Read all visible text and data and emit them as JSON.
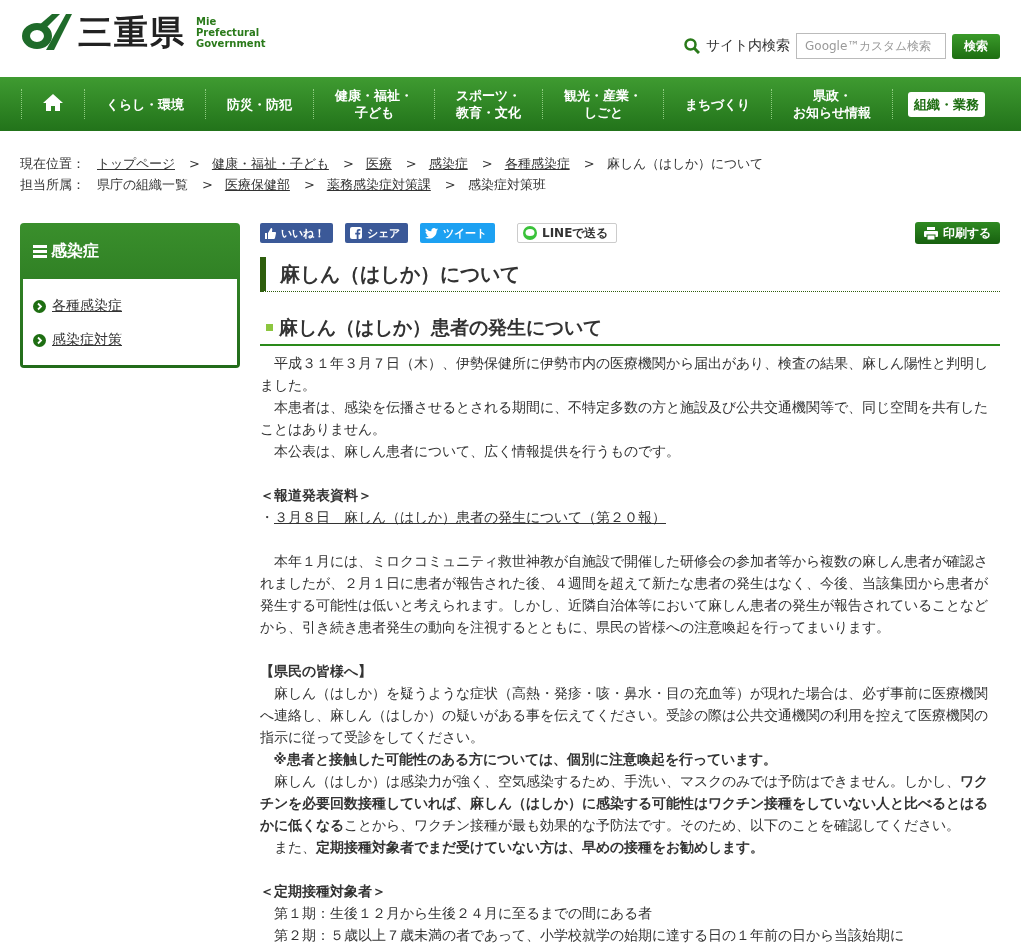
{
  "header": {
    "logo_name": "三重県",
    "logo_subtitle": "Mie\nPrefectural\nGovernment",
    "search_label": "サイト内検索",
    "search": {
      "placeholder": "Google™カスタム検索"
    },
    "search_button": "検索"
  },
  "nav": {
    "items": [
      {
        "kind": "home",
        "selected": false
      },
      {
        "kind": "link",
        "label": "くらし・環境",
        "selected": false
      },
      {
        "kind": "link",
        "label": "防災・防犯",
        "selected": false
      },
      {
        "kind": "link",
        "lines": [
          "健康・福祉・",
          "子ども"
        ],
        "selected": false
      },
      {
        "kind": "link",
        "lines": [
          "スポーツ・",
          "教育・文化"
        ],
        "selected": false
      },
      {
        "kind": "link",
        "lines": [
          "観光・産業・",
          "しごと"
        ],
        "selected": false
      },
      {
        "kind": "link",
        "label": "まちづくり",
        "selected": false
      },
      {
        "kind": "link",
        "lines": [
          "県政・",
          "お知らせ情報"
        ],
        "selected": false
      },
      {
        "kind": "link",
        "label": "組織・業務",
        "selected": true
      }
    ]
  },
  "breadcrumbs": [
    {
      "label": "現在位置：",
      "separator": ">",
      "items": [
        {
          "text": "トップページ",
          "link": true
        },
        {
          "text": "健康・福祉・子ども",
          "link": true
        },
        {
          "text": "医療",
          "link": true
        },
        {
          "text": "感染症",
          "link": true
        },
        {
          "text": "各種感染症",
          "link": true
        },
        {
          "text": "麻しん（はしか）について",
          "link": false
        }
      ]
    },
    {
      "label": "担当所属：",
      "separator": ">",
      "items": [
        {
          "text": "県庁の組織一覧",
          "link": false
        },
        {
          "text": "医療保健部",
          "link": true
        },
        {
          "text": "薬務感染症対策課",
          "link": true
        },
        {
          "text": "感染症対策班",
          "link": false
        }
      ]
    }
  ],
  "sidebar": {
    "title": "感染症",
    "items": [
      "各種感染症",
      "感染症対策"
    ]
  },
  "share_buttons": [
    {
      "kind": "like",
      "label": "いいね！"
    },
    {
      "kind": "share",
      "label": "シェア"
    },
    {
      "kind": "tweet",
      "label": "ツイート"
    },
    {
      "kind": "line",
      "label": "LINEで送る"
    }
  ],
  "print_button": "印刷する",
  "title": "麻しん（はしか）について",
  "subtitle": "麻しん（はしか）患者の発生について",
  "sections": [
    {
      "blocks": [
        {
          "kind": "para",
          "text": "平成３１年３月７日（木）、伊勢保健所に伊勢市内の医療機関から届出があり、検査の結果、麻しん陽性と判明しました。"
        },
        {
          "kind": "para",
          "text": "本患者は、感染を伝播させるとされる期間に、不特定多数の方と施設及び公共交通機関等で、同じ空間を共有したことはありません。"
        },
        {
          "kind": "para",
          "text": "本公表は、麻しん患者について、広く情報提供を行うものです。"
        }
      ]
    },
    {
      "blocks": [
        {
          "kind": "heading",
          "text": "＜報道発表資料＞"
        },
        {
          "kind": "link",
          "bullet": "・",
          "text": "３月８日　麻しん（はしか）患者の発生について（第２０報）"
        }
      ]
    },
    {
      "blocks": [
        {
          "kind": "para",
          "text": "本年１月には、ミロクコミュニティ救世神教が自施設で開催した研修会の参加者等から複数の麻しん患者が確認されましたが、２月１日に患者が報告された後、４週間を超えて新たな患者の発生はなく、今後、当該集団から患者が発生する可能性は低いと考えられます。しかし、近隣自治体等において麻しん患者の発生が報告されていることなどから、引き続き患者発生の動向を注視するとともに、県民の皆様への注意喚起を行ってまいります。"
        }
      ]
    },
    {
      "blocks": [
        {
          "kind": "heading",
          "text": "【県民の皆様へ】"
        },
        {
          "kind": "para",
          "text": "麻しん（はしか）を疑うような症状（高熱・発疹・咳・鼻水・目の充血等）が現れた場合は、必ず事前に医療機関へ連絡し、麻しん（はしか）の疑いがある事を伝えてください。受診の際は公共交通機関の利用を控えて医療機関の指示に従って受診をしてください。"
        },
        {
          "kind": "strong-para",
          "text": "※患者と接触した可能性のある方については、個別に注意喚起を行っています。"
        },
        {
          "kind": "para",
          "text": "麻しん（はしか）は感染力が強く、空気感染するため、手洗い、マスクのみでは予防はできません。しかし、**ワクチンを必要回数接種していれば、麻しん（はしか）に感染する可能性はワクチン接種をしていない人と比べるとはるかに低くなる**ことから、ワクチン接種が最も効果的な予防法です。そのため、以下のことを確認してください。"
        },
        {
          "kind": "para",
          "text": "また、**定期接種対象者でまだ受けていない方は、早めの接種をお勧めします。**"
        }
      ]
    },
    {
      "blocks": [
        {
          "kind": "heading",
          "text": "＜定期接種対象者＞"
        },
        {
          "kind": "para",
          "text": "第１期：生後１２月から生後２４月に至るまでの間にある者"
        },
        {
          "kind": "para",
          "text": "第２期：５歳以上７歳未満の者であって、小学校就学の始期に達する日の１年前の日から当該始期に"
        }
      ]
    }
  ]
}
